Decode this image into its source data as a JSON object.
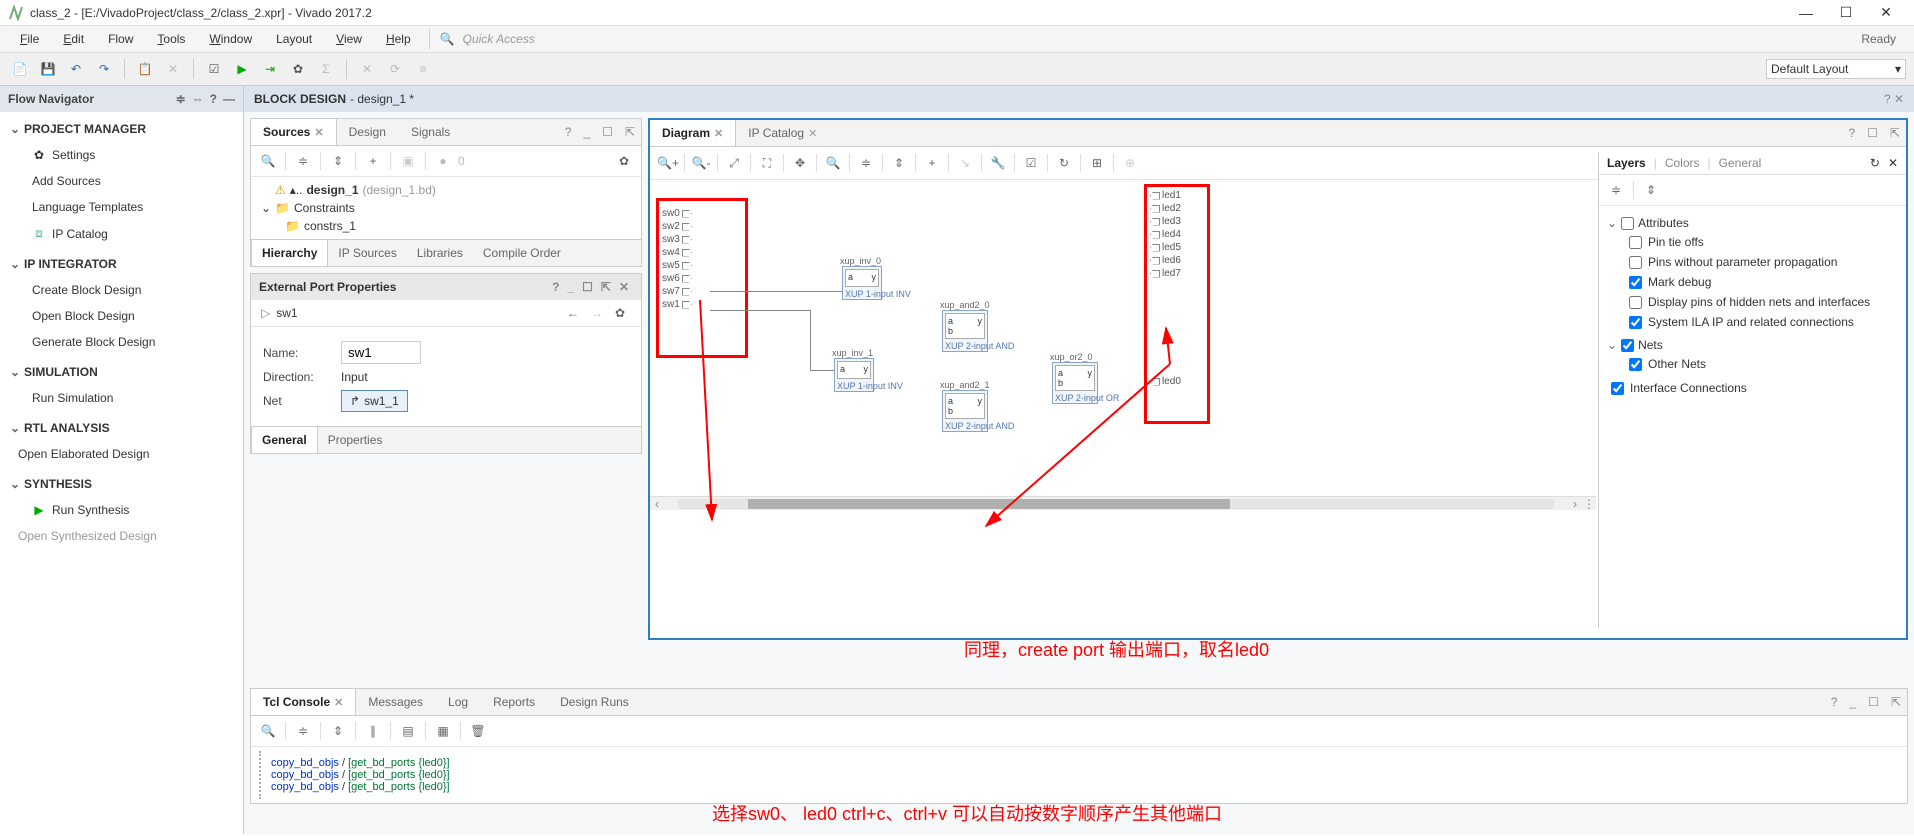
{
  "window": {
    "title": "class_2 - [E:/VivadoProject/class_2/class_2.xpr] - Vivado 2017.2",
    "min": "—",
    "max": "☐",
    "close": "✕"
  },
  "menu": {
    "file": "File",
    "edit": "Edit",
    "flow": "Flow",
    "tools": "Tools",
    "window": "Window",
    "layout": "Layout",
    "view": "View",
    "help": "Help",
    "quick_access": "Quick Access",
    "status": "Ready"
  },
  "toolbar": {
    "layout_label": "Default Layout"
  },
  "flow_navigator": {
    "title": "Flow Navigator",
    "groups": {
      "project_manager": "PROJECT MANAGER",
      "ip_integrator": "IP INTEGRATOR",
      "simulation": "SIMULATION",
      "rtl_analysis": "RTL ANALYSIS",
      "synthesis": "SYNTHESIS"
    },
    "items": {
      "settings": "Settings",
      "add_sources": "Add Sources",
      "language_templates": "Language Templates",
      "ip_catalog": "IP Catalog",
      "create_block_design": "Create Block Design",
      "open_block_design": "Open Block Design",
      "generate_block_design": "Generate Block Design",
      "run_simulation": "Run Simulation",
      "open_elaborated_design": "Open Elaborated Design",
      "run_synthesis": "Run Synthesis",
      "open_synthesized_design": "Open Synthesized Design"
    }
  },
  "block_design": {
    "header": "BLOCK DESIGN",
    "name": "- design_1 *"
  },
  "sources": {
    "tab_sources": "Sources",
    "tab_design": "Design",
    "tab_signals": "Signals",
    "count": "0",
    "design_node": "design_1",
    "design_file": "(design_1.bd)",
    "constraints": "Constraints",
    "constrs": "constrs_1",
    "subtab_hierarchy": "Hierarchy",
    "subtab_ip_sources": "IP Sources",
    "subtab_libraries": "Libraries",
    "subtab_compile_order": "Compile Order"
  },
  "external_port": {
    "title": "External Port Properties",
    "selected": "sw1",
    "name_label": "Name:",
    "name_value": "sw1",
    "direction_label": "Direction:",
    "direction_value": "Input",
    "net_label": "Net",
    "net_value": "sw1_1",
    "subtab_general": "General",
    "subtab_properties": "Properties"
  },
  "diagram": {
    "tab_diagram": "Diagram",
    "tab_ip_catalog": "IP Catalog",
    "sw_ports": [
      "sw0",
      "sw2",
      "sw3",
      "sw4",
      "sw5",
      "sw6",
      "sw7",
      "sw1"
    ],
    "led_ports": [
      "led1",
      "led2",
      "led3",
      "led4",
      "led5",
      "led6",
      "led7"
    ],
    "led0": "led0",
    "blocks": {
      "inv0_name": "xup_inv_0",
      "inv0_cap": "XUP 1-input INV",
      "inv1_name": "xup_inv_1",
      "inv1_cap": "XUP 1-input INV",
      "and0_name": "xup_and2_0",
      "and0_cap": "XUP 2-input AND",
      "and1_name": "xup_and2_1",
      "and1_cap": "XUP 2-input AND",
      "or0_name": "xup_or2_0",
      "or0_cap": "XUP 2-input OR"
    }
  },
  "layers": {
    "tab_layers": "Layers",
    "tab_colors": "Colors",
    "tab_general": "General",
    "attributes": "Attributes",
    "pin_tie_offs": "Pin tie offs",
    "pins_wo_param": "Pins without parameter propagation",
    "mark_debug": "Mark debug",
    "display_hidden": "Display pins of hidden nets and interfaces",
    "system_ila": "System ILA IP and related connections",
    "nets": "Nets",
    "other_nets": "Other Nets",
    "iface_conn": "Interface Connections"
  },
  "tcl": {
    "tab_tcl": "Tcl Console",
    "tab_messages": "Messages",
    "tab_log": "Log",
    "tab_reports": "Reports",
    "tab_design_runs": "Design Runs",
    "lines": [
      {
        "cmd": "copy_bd_objs",
        "sep": " /  ",
        "arg": "[get_bd_ports {led0}]"
      },
      {
        "cmd": "copy_bd_objs",
        "sep": " /  ",
        "arg": "[get_bd_ports {led0}]"
      },
      {
        "cmd": "copy_bd_objs",
        "sep": " /  ",
        "arg": "[get_bd_ports {led0}]"
      }
    ]
  },
  "annotations": {
    "top": "同理，create port 输出端口，取名led0",
    "bottom": "选择sw0、 led0 ctrl+c、ctrl+v 可以自动按数字顺序产生其他端口"
  }
}
